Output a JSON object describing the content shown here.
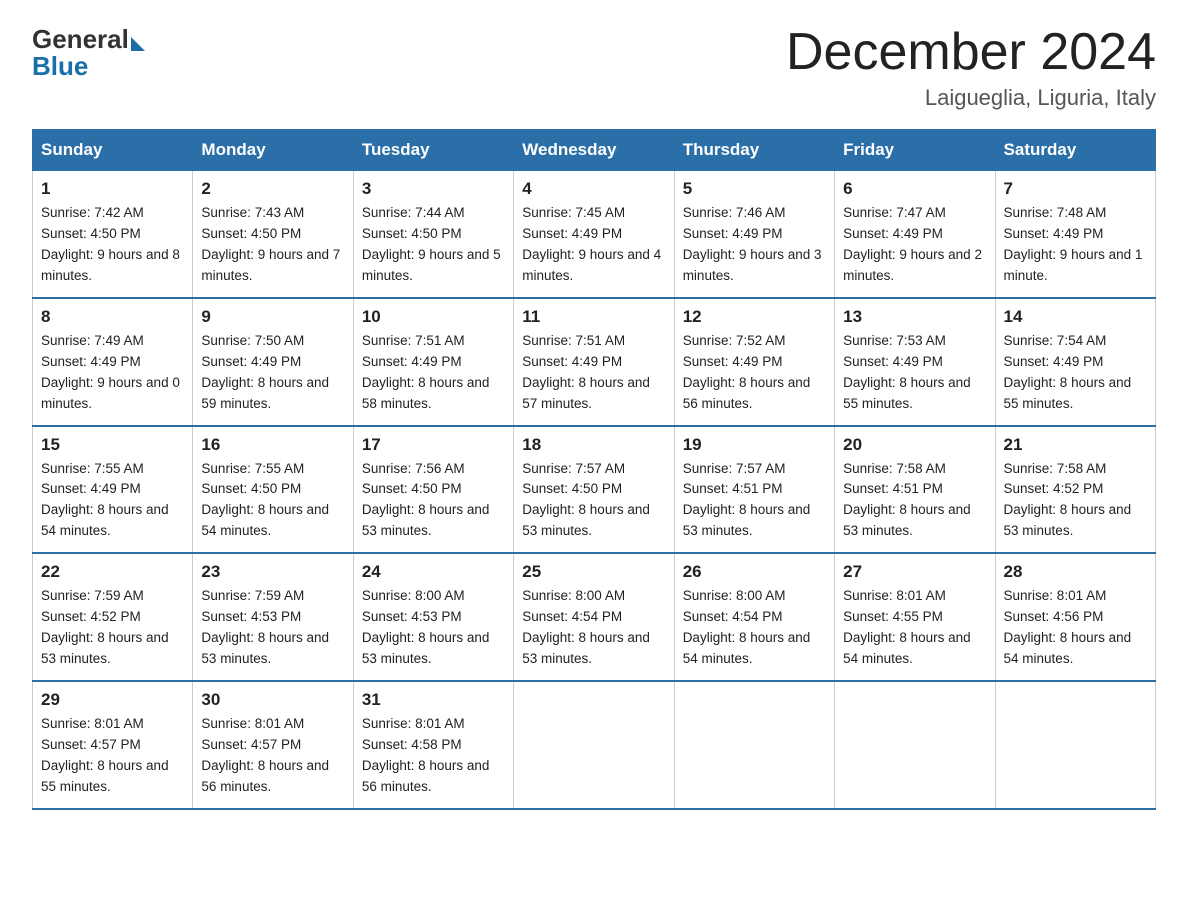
{
  "logo": {
    "general": "General",
    "blue": "Blue"
  },
  "title": "December 2024",
  "location": "Laigueglia, Liguria, Italy",
  "days_of_week": [
    "Sunday",
    "Monday",
    "Tuesday",
    "Wednesday",
    "Thursday",
    "Friday",
    "Saturday"
  ],
  "weeks": [
    [
      {
        "num": "1",
        "sunrise": "7:42 AM",
        "sunset": "4:50 PM",
        "daylight": "9 hours and 8 minutes."
      },
      {
        "num": "2",
        "sunrise": "7:43 AM",
        "sunset": "4:50 PM",
        "daylight": "9 hours and 7 minutes."
      },
      {
        "num": "3",
        "sunrise": "7:44 AM",
        "sunset": "4:50 PM",
        "daylight": "9 hours and 5 minutes."
      },
      {
        "num": "4",
        "sunrise": "7:45 AM",
        "sunset": "4:49 PM",
        "daylight": "9 hours and 4 minutes."
      },
      {
        "num": "5",
        "sunrise": "7:46 AM",
        "sunset": "4:49 PM",
        "daylight": "9 hours and 3 minutes."
      },
      {
        "num": "6",
        "sunrise": "7:47 AM",
        "sunset": "4:49 PM",
        "daylight": "9 hours and 2 minutes."
      },
      {
        "num": "7",
        "sunrise": "7:48 AM",
        "sunset": "4:49 PM",
        "daylight": "9 hours and 1 minute."
      }
    ],
    [
      {
        "num": "8",
        "sunrise": "7:49 AM",
        "sunset": "4:49 PM",
        "daylight": "9 hours and 0 minutes."
      },
      {
        "num": "9",
        "sunrise": "7:50 AM",
        "sunset": "4:49 PM",
        "daylight": "8 hours and 59 minutes."
      },
      {
        "num": "10",
        "sunrise": "7:51 AM",
        "sunset": "4:49 PM",
        "daylight": "8 hours and 58 minutes."
      },
      {
        "num": "11",
        "sunrise": "7:51 AM",
        "sunset": "4:49 PM",
        "daylight": "8 hours and 57 minutes."
      },
      {
        "num": "12",
        "sunrise": "7:52 AM",
        "sunset": "4:49 PM",
        "daylight": "8 hours and 56 minutes."
      },
      {
        "num": "13",
        "sunrise": "7:53 AM",
        "sunset": "4:49 PM",
        "daylight": "8 hours and 55 minutes."
      },
      {
        "num": "14",
        "sunrise": "7:54 AM",
        "sunset": "4:49 PM",
        "daylight": "8 hours and 55 minutes."
      }
    ],
    [
      {
        "num": "15",
        "sunrise": "7:55 AM",
        "sunset": "4:49 PM",
        "daylight": "8 hours and 54 minutes."
      },
      {
        "num": "16",
        "sunrise": "7:55 AM",
        "sunset": "4:50 PM",
        "daylight": "8 hours and 54 minutes."
      },
      {
        "num": "17",
        "sunrise": "7:56 AM",
        "sunset": "4:50 PM",
        "daylight": "8 hours and 53 minutes."
      },
      {
        "num": "18",
        "sunrise": "7:57 AM",
        "sunset": "4:50 PM",
        "daylight": "8 hours and 53 minutes."
      },
      {
        "num": "19",
        "sunrise": "7:57 AM",
        "sunset": "4:51 PM",
        "daylight": "8 hours and 53 minutes."
      },
      {
        "num": "20",
        "sunrise": "7:58 AM",
        "sunset": "4:51 PM",
        "daylight": "8 hours and 53 minutes."
      },
      {
        "num": "21",
        "sunrise": "7:58 AM",
        "sunset": "4:52 PM",
        "daylight": "8 hours and 53 minutes."
      }
    ],
    [
      {
        "num": "22",
        "sunrise": "7:59 AM",
        "sunset": "4:52 PM",
        "daylight": "8 hours and 53 minutes."
      },
      {
        "num": "23",
        "sunrise": "7:59 AM",
        "sunset": "4:53 PM",
        "daylight": "8 hours and 53 minutes."
      },
      {
        "num": "24",
        "sunrise": "8:00 AM",
        "sunset": "4:53 PM",
        "daylight": "8 hours and 53 minutes."
      },
      {
        "num": "25",
        "sunrise": "8:00 AM",
        "sunset": "4:54 PM",
        "daylight": "8 hours and 53 minutes."
      },
      {
        "num": "26",
        "sunrise": "8:00 AM",
        "sunset": "4:54 PM",
        "daylight": "8 hours and 54 minutes."
      },
      {
        "num": "27",
        "sunrise": "8:01 AM",
        "sunset": "4:55 PM",
        "daylight": "8 hours and 54 minutes."
      },
      {
        "num": "28",
        "sunrise": "8:01 AM",
        "sunset": "4:56 PM",
        "daylight": "8 hours and 54 minutes."
      }
    ],
    [
      {
        "num": "29",
        "sunrise": "8:01 AM",
        "sunset": "4:57 PM",
        "daylight": "8 hours and 55 minutes."
      },
      {
        "num": "30",
        "sunrise": "8:01 AM",
        "sunset": "4:57 PM",
        "daylight": "8 hours and 56 minutes."
      },
      {
        "num": "31",
        "sunrise": "8:01 AM",
        "sunset": "4:58 PM",
        "daylight": "8 hours and 56 minutes."
      },
      null,
      null,
      null,
      null
    ]
  ]
}
